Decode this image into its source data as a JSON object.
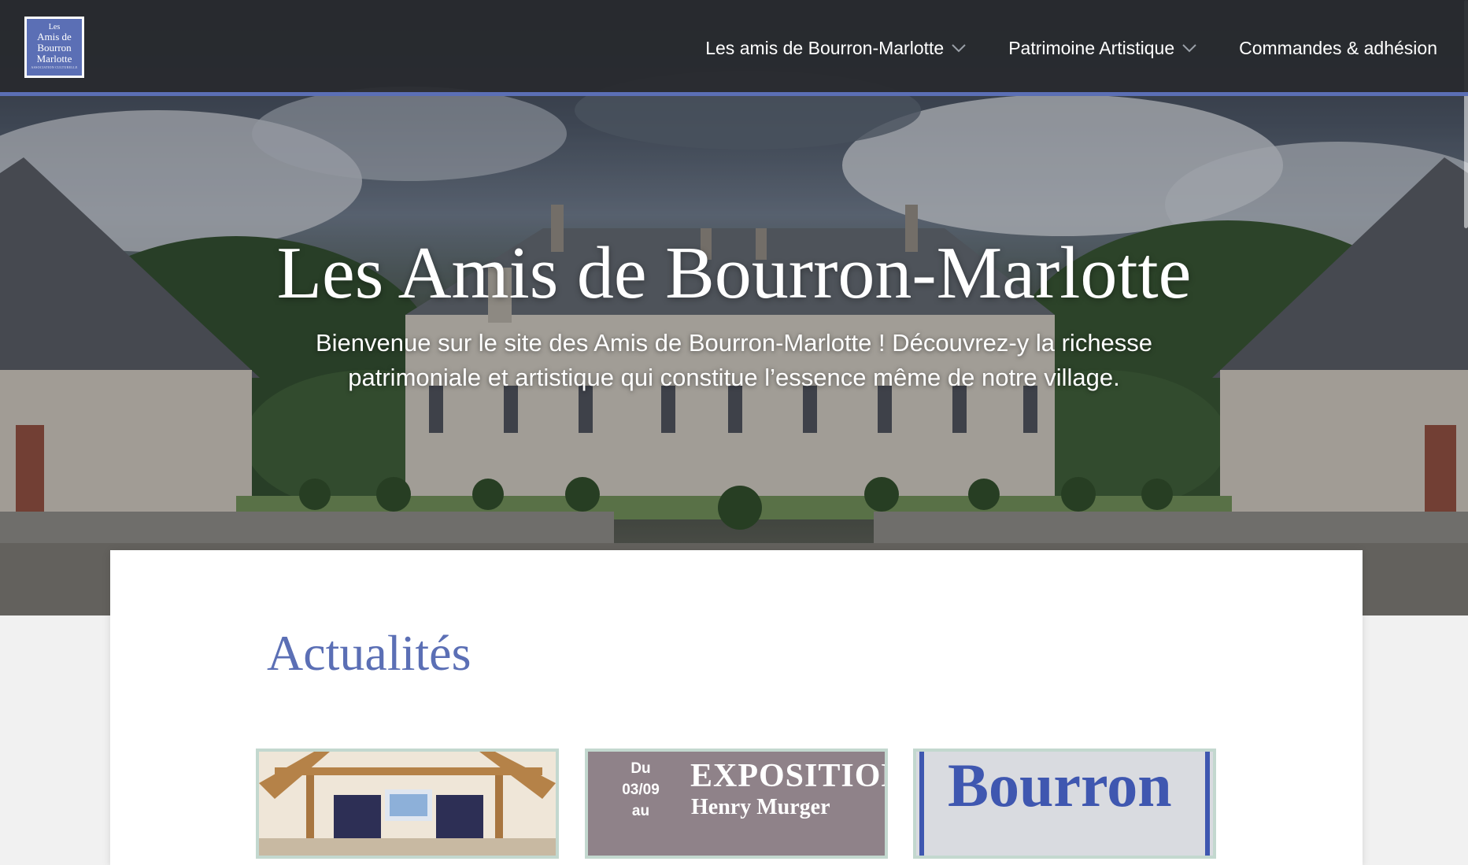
{
  "header": {
    "logo": {
      "line1": "Les",
      "line2": "Amis de",
      "line3": "Bourron",
      "line4": "Marlotte",
      "tagline": "ASSOCIATION CULTURELLE"
    },
    "nav": [
      {
        "label": "Les amis de Bourron-Marlotte",
        "has_dropdown": true
      },
      {
        "label": "Patrimoine Artistique",
        "has_dropdown": true
      },
      {
        "label": "Commandes & adhésion",
        "has_dropdown": false
      }
    ]
  },
  "hero": {
    "title": "Les Amis de Bourron-Marlotte",
    "subtitle": "Bienvenue sur le site des Amis de Bourron-Marlotte ! Découvrez-y la richesse patrimoniale et artistique qui constitue l’essence même de notre village."
  },
  "news": {
    "title": "Actualités",
    "items": [
      {
        "kind": "photo"
      },
      {
        "kind": "poster",
        "date_line1": "Du",
        "date_line2": "03/09",
        "date_line3": "au",
        "title": "EXPOSITION",
        "subtitle": "Henry Murger"
      },
      {
        "kind": "text",
        "text": "Bourron"
      }
    ]
  },
  "colors": {
    "accent": "#5b6fb5",
    "header_bg": "#2a2c30",
    "page_bg": "#f1f1f1"
  }
}
